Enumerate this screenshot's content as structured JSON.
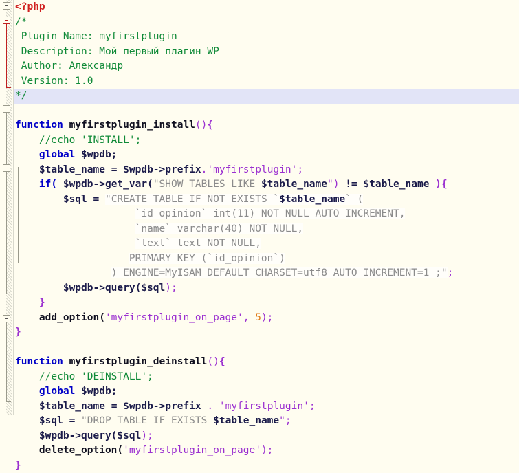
{
  "editor": {
    "language": "php",
    "background_color": "#fffdf0",
    "current_line_highlight_color": "#e2e4f7",
    "gutter_color": "#d8d8cc",
    "colors": {
      "keyword": "#0000c8",
      "comment": "#108a38",
      "string": "#8b8b8b",
      "string_quote": "#9b30d0",
      "number": "#e07b18",
      "variable": "#1b1b4a",
      "punctuation": "#9b30d0",
      "php_tag": "#d02020"
    },
    "current_line_number": 8
  },
  "plugin_header": {
    "name_label": "Plugin Name:",
    "name_value": "myfirstplugin",
    "description_label": "Description:",
    "description_value": "Мой первый плагин WP",
    "author_label": "Author:",
    "author_value": "Александр",
    "version_label": "Version:",
    "version_value": "1.0"
  },
  "code": {
    "php_open_tag": "<?php",
    "comment_open": "/*",
    "comment_close": "*/",
    "line_plugin_name": " Plugin Name: myfirstplugin",
    "line_description": " Description: Мой первый плагин WP",
    "line_author": " Author: Александр",
    "line_version": " Version: 1.0",
    "install": {
      "keyword": "function",
      "name": "myfirstplugin_install",
      "parens": "()",
      "open_brace": "{",
      "close_brace": "}",
      "comment_echo": "//echo 'INSTALL';",
      "global_kw": "global",
      "global_var": "$wpdb;",
      "table_name_var": "$table_name",
      "assign": "=",
      "wpdb_prefix": "$wpdb->prefix",
      "concat_dot": ".",
      "table_suffix_string": "'myfirstplugin'",
      "semicolon": ";",
      "if_kw": "if(",
      "get_var_call": "$wpdb->get_var(",
      "show_tables_sql_pre": "\"SHOW TABLES LIKE ",
      "show_tables_sql_var": "$table_name",
      "show_tables_sql_post": "\")",
      "not_equal": "!=",
      "compare_var": "$table_name",
      "if_close": "){",
      "sql_var": "$sql",
      "create_sql_l1_pre": "\"CREATE TABLE IF NOT EXISTS `",
      "create_sql_l1_var": "$table_name",
      "create_sql_l1_post": "` (",
      "create_sql_l2": "`id_opinion` int(11) NOT NULL AUTO_INCREMENT,",
      "create_sql_l3": "`name` varchar(40) NOT NULL,",
      "create_sql_l4": "`text` text NOT NULL,",
      "create_sql_l5": "PRIMARY KEY (`id_opinion`)",
      "create_sql_l6": ") ENGINE=MyISAM DEFAULT CHARSET=utf8 AUTO_INCREMENT=1 ;\"",
      "query_call": "$wpdb->query(",
      "query_arg": "$sql",
      "query_close": ");",
      "add_option_fn": "add_option(",
      "add_option_key": "'myfirstplugin_on_page'",
      "add_option_comma": ",",
      "add_option_value": "5",
      "add_option_close": ");"
    },
    "deinstall": {
      "keyword": "function",
      "name": "myfirstplugin_deinstall",
      "parens": "()",
      "open_brace": "{",
      "close_brace": "}",
      "comment_echo": "//echo 'DEINSTALL';",
      "global_kw": "global",
      "global_var": "$wpdb;",
      "table_name_var": "$table_name",
      "assign": "=",
      "wpdb_prefix": "$wpdb->prefix",
      "concat_dot": ".",
      "table_suffix_string": "'myfirstplugin'",
      "semicolon": ";",
      "sql_var": "$sql",
      "drop_sql_pre": "\"DROP TABLE IF EXISTS ",
      "drop_sql_var": "$table_name",
      "drop_sql_post": "\"",
      "query_call": "$wpdb->query(",
      "query_arg": "$sql",
      "query_close": ");",
      "delete_option_fn": "delete_option(",
      "delete_option_key": "'myfirstplugin_on_page'",
      "delete_option_close": ");"
    }
  }
}
